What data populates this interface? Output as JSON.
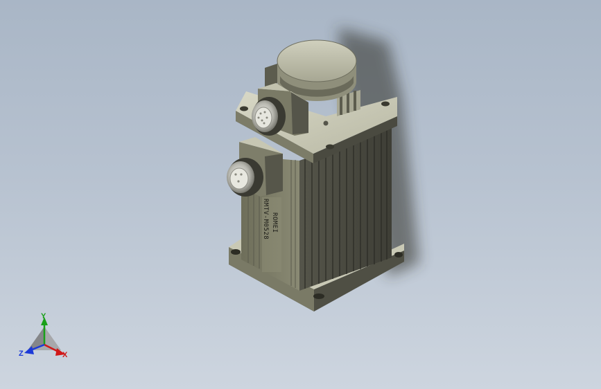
{
  "viewport": {
    "model": {
      "brand_text": "ROMEI",
      "model_text": "RMTV-M0528"
    },
    "triad": {
      "x_label": "X",
      "y_label": "Y",
      "z_label": "Z",
      "x_color": "#d01818",
      "y_color": "#19a019",
      "z_color": "#1c3ad8"
    }
  }
}
